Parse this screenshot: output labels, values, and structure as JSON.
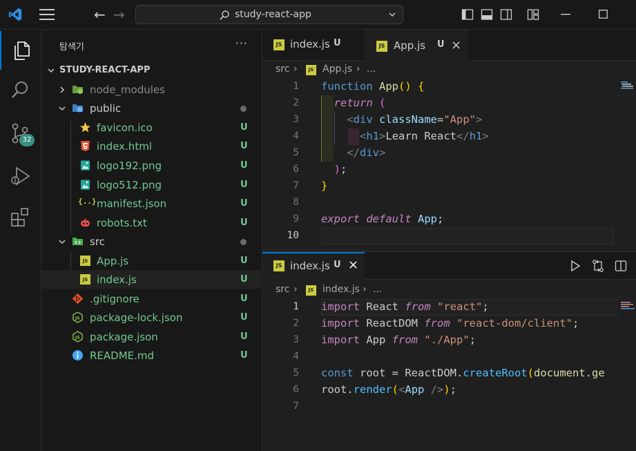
{
  "titlebar": {
    "search_text": "study-react-app"
  },
  "activity": {
    "scm_badge": "32"
  },
  "explorer": {
    "title": "탐색기",
    "more": "···",
    "section": "STUDY-REACT-APP",
    "items": [
      {
        "name": "node_modules",
        "status": ""
      },
      {
        "name": "public",
        "status": ""
      },
      {
        "name": "favicon.ico",
        "status": "U"
      },
      {
        "name": "index.html",
        "status": "U"
      },
      {
        "name": "logo192.png",
        "status": "U"
      },
      {
        "name": "logo512.png",
        "status": "U"
      },
      {
        "name": "manifest.json",
        "status": "U"
      },
      {
        "name": "robots.txt",
        "status": "U"
      },
      {
        "name": "src",
        "status": ""
      },
      {
        "name": "App.js",
        "status": "U"
      },
      {
        "name": "index.js",
        "status": "U"
      },
      {
        "name": ".gitignore",
        "status": "U"
      },
      {
        "name": "package-lock.json",
        "status": "U"
      },
      {
        "name": "package.json",
        "status": "U"
      },
      {
        "name": "README.md",
        "status": "U"
      }
    ]
  },
  "editor_top": {
    "tabs": [
      {
        "label": "index.js",
        "mod": "U"
      },
      {
        "label": "App.js",
        "mod": "U"
      }
    ],
    "breadcrumb": {
      "folder": "src",
      "file": "App.js",
      "more": "..."
    },
    "line_numbers": [
      "1",
      "2",
      "3",
      "4",
      "5",
      "6",
      "7",
      "8",
      "9",
      "10"
    ]
  },
  "editor_bottom": {
    "tabs": [
      {
        "label": "index.js",
        "mod": "U"
      }
    ],
    "breadcrumb": {
      "folder": "src",
      "file": "index.js",
      "more": "..."
    },
    "line_numbers": [
      "1",
      "2",
      "3",
      "4",
      "5",
      "6",
      "7"
    ]
  },
  "icons": {
    "js": "JS",
    "json": "{..}"
  },
  "colors": {
    "accent": "#0078d4",
    "untracked": "#73c991",
    "js_icon": "#cbcb41"
  }
}
